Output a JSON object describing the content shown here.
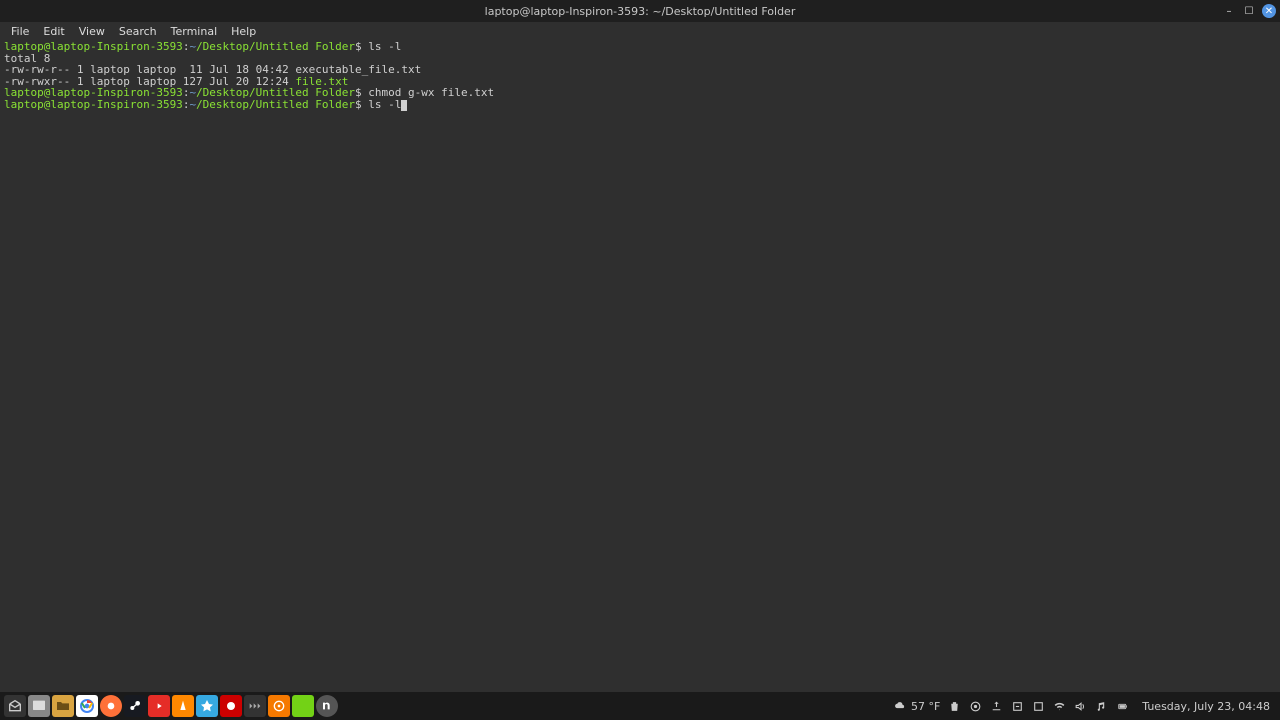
{
  "window": {
    "title": "laptop@laptop-Inspiron-3593: ~/Desktop/Untitled Folder"
  },
  "menubar": {
    "items": [
      "File",
      "Edit",
      "View",
      "Search",
      "Terminal",
      "Help"
    ]
  },
  "terminal": {
    "prompt_user": "laptop@laptop-Inspiron-3593",
    "prompt_sep": ":",
    "prompt_path_home": "~",
    "prompt_path_rest": "/Desktop/Untitled Folder",
    "prompt_suffix": "$",
    "lines": {
      "cmd1": "ls -l",
      "total": "total 8",
      "row1": "-rw-rw-r-- 1 laptop laptop  11 Jul 18 04:42 executable_file.txt",
      "row2_perm": "-rw-rwxr-- 1 laptop laptop 127 Jul 20 12:24 ",
      "row2_file": "file.txt",
      "cmd2": "chmod g-wx file.txt",
      "cmd3": "ls -l"
    }
  },
  "taskbar": {
    "weather_temp": "57 °F",
    "clock": "Tuesday, July 23, 04:48"
  }
}
